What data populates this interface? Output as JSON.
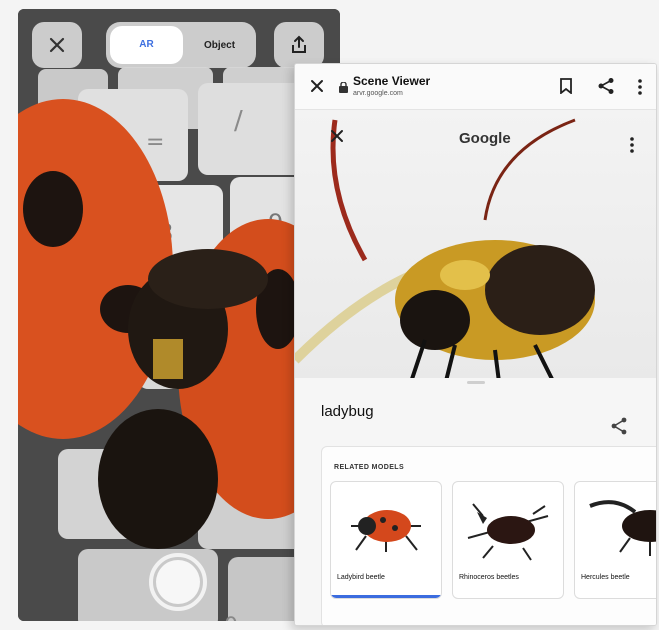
{
  "ar_camera": {
    "modes": [
      "AR",
      "Object"
    ],
    "active_mode": "AR",
    "icons": {
      "close": "close-icon",
      "share": "share-upload-icon",
      "shutter": "shutter-icon"
    }
  },
  "scene_viewer": {
    "url_bar": {
      "title": "Scene Viewer",
      "domain": "arvr.google.com"
    },
    "brand": "Google",
    "model_name": "ladybug",
    "related_label": "RELATED MODELS",
    "related_models": [
      {
        "label": "Ladybird beetle",
        "selected": true
      },
      {
        "label": "Rhinoceros beetles",
        "selected": false
      },
      {
        "label": "Hercules beetle",
        "selected": false
      }
    ],
    "accent_color": "#3b6cdf"
  }
}
